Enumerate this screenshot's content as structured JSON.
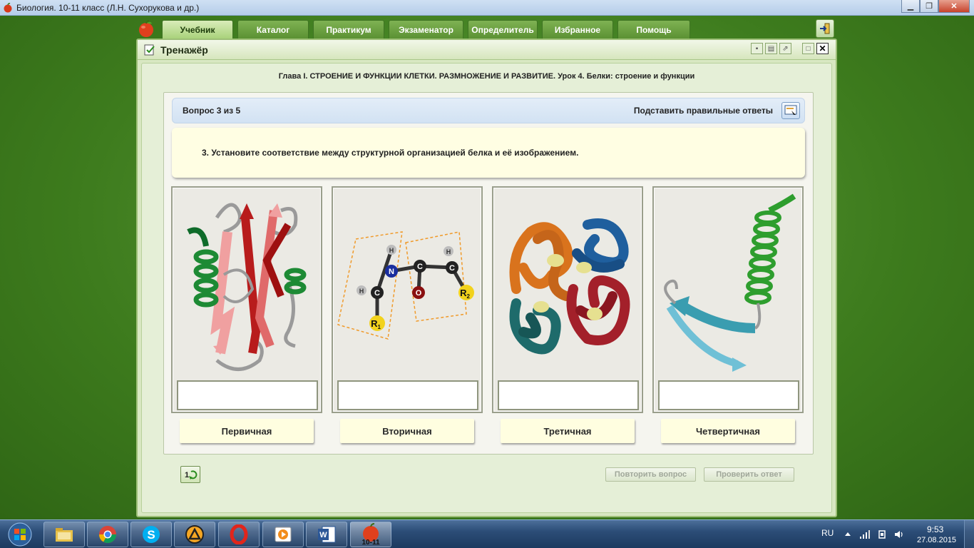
{
  "window": {
    "title": "Биология. 10-11 класс (Л.Н. Сухорукова и др.)",
    "controls": {
      "minimize": "▁",
      "maximize": "❐",
      "close": "✕"
    }
  },
  "nav": {
    "tabs": [
      {
        "label": "Учебник",
        "active": true
      },
      {
        "label": "Каталог",
        "active": false
      },
      {
        "label": "Практикум",
        "active": false
      },
      {
        "label": "Экзаменатор",
        "active": false
      },
      {
        "label": "Определитель",
        "active": false
      },
      {
        "label": "Избранное",
        "active": false
      },
      {
        "label": "Помощь",
        "active": false
      }
    ]
  },
  "panel": {
    "title": "Тренажёр",
    "chapter": "Глава I. СТРОЕНИЕ И ФУНКЦИИ КЛЕТКИ. РАЗМНОЖЕНИЕ И РАЗВИТИЕ. Урок 4. Белки: строение и функции"
  },
  "question": {
    "counter": "Вопрос 3 из 5",
    "fill_answers_label": "Подставить правильные ответы",
    "text": "3. Установите соответствие между структурной организацией белка и её изображением.",
    "molecule_labels": {
      "h": "H",
      "n": "N",
      "c": "C",
      "o": "O",
      "r1": "R",
      "r1_sub": "1",
      "r2": "R",
      "r2_sub": "2"
    }
  },
  "answers": [
    "Первичная",
    "Вторичная",
    "Третичная",
    "Четвертичная"
  ],
  "actions": {
    "reset_label": "1",
    "repeat_label": "Повторить вопрос",
    "check_label": "Проверить ответ"
  },
  "taskbar": {
    "active_app_label": "10-11",
    "language": "RU",
    "time": "9:53",
    "date": "27.08.2015"
  }
}
